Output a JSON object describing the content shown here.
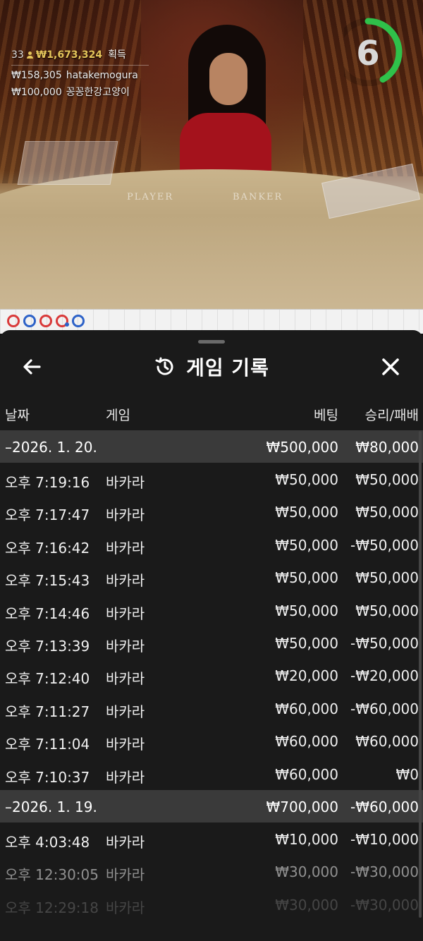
{
  "video": {
    "winners": {
      "count": "33",
      "total": "₩1,673,324",
      "suffix": "획득",
      "top": [
        {
          "amount": "₩158,305",
          "name": "hatakemogura"
        },
        {
          "amount": "₩100,000",
          "name": "꽁꽁한강고양이"
        }
      ]
    },
    "timer": {
      "value": "6",
      "progress": 0.42,
      "color": "#2fc14a"
    },
    "table_labels": {
      "player": "PLAYER",
      "banker": "BANKER"
    }
  },
  "road": {
    "beads": [
      {
        "color": "#d93a3a"
      },
      {
        "color": "#2d62c8"
      },
      {
        "color": "#d93a3a"
      },
      {
        "color": "#d93a3a",
        "dot": true
      },
      {
        "color": "#2d62c8"
      }
    ]
  },
  "sheet": {
    "title": "게임 기록",
    "icons": {
      "back": "arrow-left-icon",
      "history": "history-icon",
      "close": "close-icon"
    },
    "columns": {
      "date": "날짜",
      "game": "게임",
      "bet": "베팅",
      "result": "승리/패배"
    },
    "groups": [
      {
        "date": "–2026. 1. 20.",
        "bet_total": "₩500,000",
        "result_total": "₩80,000",
        "rows": [
          {
            "time": "오후 7:19:16",
            "game": "바카라",
            "bet": "₩50,000",
            "result": "₩50,000"
          },
          {
            "time": "오후 7:17:47",
            "game": "바카라",
            "bet": "₩50,000",
            "result": "₩50,000"
          },
          {
            "time": "오후 7:16:42",
            "game": "바카라",
            "bet": "₩50,000",
            "result": "-₩50,000"
          },
          {
            "time": "오후 7:15:43",
            "game": "바카라",
            "bet": "₩50,000",
            "result": "₩50,000"
          },
          {
            "time": "오후 7:14:46",
            "game": "바카라",
            "bet": "₩50,000",
            "result": "₩50,000"
          },
          {
            "time": "오후 7:13:39",
            "game": "바카라",
            "bet": "₩50,000",
            "result": "-₩50,000"
          },
          {
            "time": "오후 7:12:40",
            "game": "바카라",
            "bet": "₩20,000",
            "result": "-₩20,000"
          },
          {
            "time": "오후 7:11:27",
            "game": "바카라",
            "bet": "₩60,000",
            "result": "-₩60,000"
          },
          {
            "time": "오후 7:11:04",
            "game": "바카라",
            "bet": "₩60,000",
            "result": "₩60,000"
          },
          {
            "time": "오후 7:10:37",
            "game": "바카라",
            "bet": "₩60,000",
            "result": "₩0"
          }
        ]
      },
      {
        "date": "–2026. 1. 19.",
        "bet_total": "₩700,000",
        "result_total": "-₩60,000",
        "rows": [
          {
            "time": "오후 4:03:48",
            "game": "바카라",
            "bet": "₩10,000",
            "result": "-₩10,000"
          },
          {
            "time": "오후 12:30:05",
            "game": "바카라",
            "bet": "₩30,000",
            "result": "-₩30,000"
          },
          {
            "time": "오후 12:29:18",
            "game": "바카라",
            "bet": "₩30,000",
            "result": "-₩30,000"
          }
        ]
      }
    ]
  }
}
